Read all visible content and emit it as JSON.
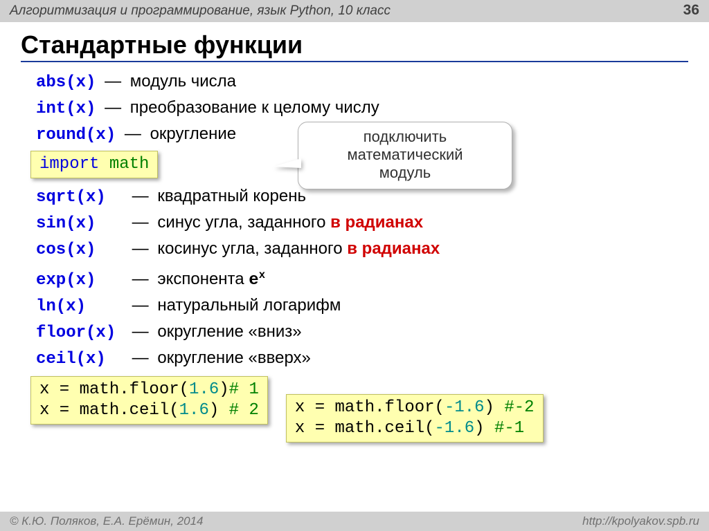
{
  "header": {
    "course": "Алгоритмизация и программирование, язык Python, 10 класс",
    "page": "36"
  },
  "title": "Стандартные функции",
  "funcs1": [
    {
      "name": "abs(x)",
      "desc": "модуль числа"
    },
    {
      "name": "int(x)",
      "desc": "преобразование к целому числу"
    },
    {
      "name": "round(x)",
      "desc": "округление"
    }
  ],
  "import_kw": "import",
  "import_mod": "math",
  "callout": {
    "l1": "подключить",
    "l2": "математический",
    "l3": "модуль"
  },
  "funcs2": [
    {
      "name": "sqrt(x)",
      "desc": "квадратный корень",
      "red": ""
    },
    {
      "name": "sin(x)",
      "desc": "синус угла, заданного ",
      "red": "в радианах"
    },
    {
      "name": "cos(x)",
      "desc": "косинус угла, заданного ",
      "red": "в радианах"
    },
    {
      "name": "exp(x)",
      "desc": "экспонента ",
      "mono": "e",
      "sup": "x"
    },
    {
      "name": "ln(x)",
      "desc": "натуральный логарифм"
    },
    {
      "name": "floor(x)",
      "desc": "округление «вниз»"
    },
    {
      "name": "ceil(x)",
      "desc": "округление «вверх»"
    }
  ],
  "ex": {
    "left": {
      "p1": "x = math.floor(",
      "a1": "1.6",
      "s1": ")",
      "c1": "# 1",
      "p2": "x = math.ceil(",
      "a2": "1.6",
      "s2": ") ",
      "c2": "# 2"
    },
    "right": {
      "p1": "x = math.floor(",
      "a1": "-1.6",
      "s1": ") ",
      "c1": "#-2",
      "p2": "x = math.ceil(",
      "a2": "-1.6",
      "s2": ")  ",
      "c2": "#-1"
    }
  },
  "footer": {
    "left": "© К.Ю. Поляков, Е.А. Ерёмин, 2014",
    "right": "http://kpolyakov.spb.ru"
  }
}
